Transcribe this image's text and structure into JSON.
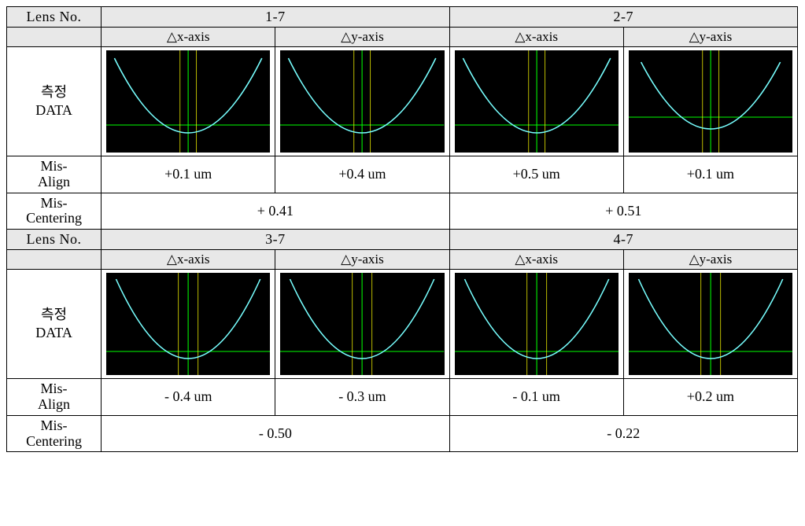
{
  "labels": {
    "lens_no": "Lens No.",
    "dx_axis": "△x-axis",
    "dy_axis": "△y-axis",
    "data_label_line1": "측정",
    "data_label_line2": "DATA",
    "mis_align_line1": "Mis-",
    "mis_align_line2": "Align",
    "mis_center_line1": "Mis-",
    "mis_center_line2": "Centering"
  },
  "blocks": [
    {
      "left": {
        "lens_no": "1-7",
        "dx_misalign": "+0.1 um",
        "dy_misalign": "+0.4 um",
        "miscentering": "+ 0.41"
      },
      "right": {
        "lens_no": "2-7",
        "dx_misalign": "+0.5 um",
        "dy_misalign": "+0.1 um",
        "miscentering": "+ 0.51"
      }
    },
    {
      "left": {
        "lens_no": "3-7",
        "dx_misalign": "- 0.4 um",
        "dy_misalign": "- 0.3 um",
        "miscentering": "- 0.50"
      },
      "right": {
        "lens_no": "4-7",
        "dx_misalign": "- 0.1 um",
        "dy_misalign": "+0.2 um",
        "miscentering": "- 0.22"
      }
    }
  ],
  "chart_data": [
    {
      "lens": "1-7",
      "axis": "x",
      "type": "line",
      "profile": "parabolic-up",
      "crosshair": true
    },
    {
      "lens": "1-7",
      "axis": "y",
      "type": "line",
      "profile": "parabolic-up",
      "crosshair": true
    },
    {
      "lens": "2-7",
      "axis": "x",
      "type": "line",
      "profile": "parabolic-up",
      "crosshair": true
    },
    {
      "lens": "2-7",
      "axis": "y",
      "type": "line",
      "profile": "parabolic-up",
      "crosshair": true
    },
    {
      "lens": "3-7",
      "axis": "x",
      "type": "line",
      "profile": "parabolic-up",
      "crosshair": true
    },
    {
      "lens": "3-7",
      "axis": "y",
      "type": "line",
      "profile": "parabolic-up",
      "crosshair": true
    },
    {
      "lens": "4-7",
      "axis": "x",
      "type": "line",
      "profile": "parabolic-up",
      "crosshair": true
    },
    {
      "lens": "4-7",
      "axis": "y",
      "type": "line",
      "profile": "parabolic-up",
      "crosshair": true
    }
  ]
}
